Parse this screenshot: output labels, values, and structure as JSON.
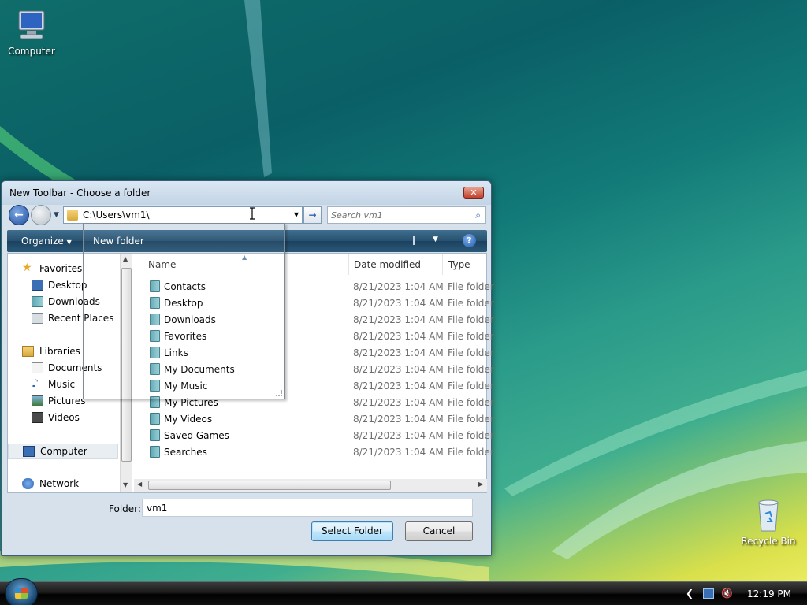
{
  "desktop": {
    "icons": [
      {
        "label": "Computer"
      },
      {
        "label": "Recycle Bin"
      }
    ]
  },
  "dialog": {
    "title": "New Toolbar - Choose a folder",
    "close_label": "✕",
    "address": "C:\\Users\\vm1\\",
    "search_placeholder": "Search vm1",
    "organize_label": "Organize",
    "newfolder_label": "New folder",
    "help_label": "?",
    "nav": {
      "favorites": "Favorites",
      "desktop": "Desktop",
      "downloads": "Downloads",
      "recent_places": "Recent Places",
      "libraries": "Libraries",
      "documents": "Documents",
      "music": "Music",
      "pictures": "Pictures",
      "videos": "Videos",
      "computer": "Computer",
      "network": "Network"
    },
    "columns": {
      "name": "Name",
      "date_modified": "Date modified",
      "type": "Type"
    },
    "files": [
      {
        "name": "Contacts",
        "date": "8/21/2023 1:04 AM",
        "type": "File folder"
      },
      {
        "name": "Desktop",
        "date": "8/21/2023 1:04 AM",
        "type": "File folder"
      },
      {
        "name": "Downloads",
        "date": "8/21/2023 1:04 AM",
        "type": "File folder"
      },
      {
        "name": "Favorites",
        "date": "8/21/2023 1:04 AM",
        "type": "File folder"
      },
      {
        "name": "Links",
        "date": "8/21/2023 1:04 AM",
        "type": "File folder"
      },
      {
        "name": "My Documents",
        "date": "8/21/2023 1:04 AM",
        "type": "File folder"
      },
      {
        "name": "My Music",
        "date": "8/21/2023 1:04 AM",
        "type": "File folder"
      },
      {
        "name": "My Pictures",
        "date": "8/21/2023 1:04 AM",
        "type": "File folder"
      },
      {
        "name": "My Videos",
        "date": "8/21/2023 1:04 AM",
        "type": "File folder"
      },
      {
        "name": "Saved Games",
        "date": "8/21/2023 1:04 AM",
        "type": "File folder"
      },
      {
        "name": "Searches",
        "date": "8/21/2023 1:04 AM",
        "type": "File folder"
      }
    ],
    "folder_label": "Folder:",
    "folder_value": "vm1",
    "select_button": "Select Folder",
    "cancel_button": "Cancel"
  },
  "taskbar": {
    "clock": "12:19 PM"
  }
}
